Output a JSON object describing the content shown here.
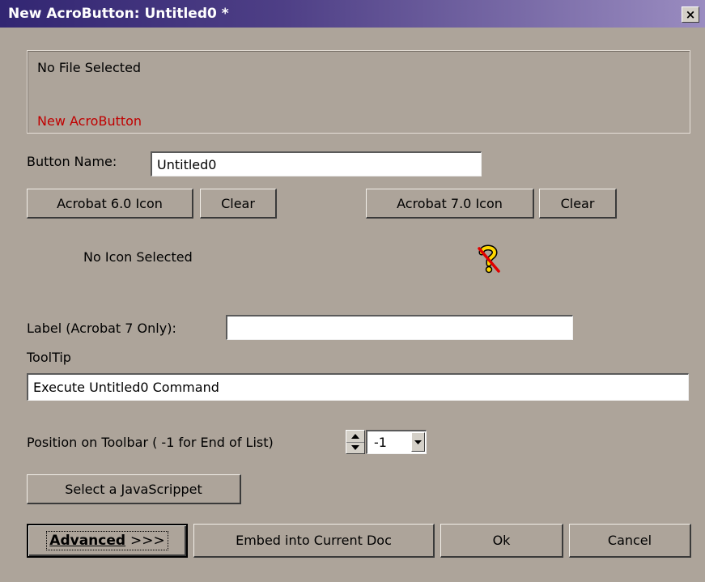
{
  "window": {
    "title": "New AcroButton: Untitled0 *",
    "close_label": "×"
  },
  "file_info": {
    "file_status": "No File Selected",
    "button_caption": "New AcroButton"
  },
  "button_name": {
    "label": "Button Name:",
    "value": "Untitled0"
  },
  "icons": {
    "acrobat6_button": "Acrobat 6.0 Icon",
    "clear6_button": "Clear",
    "acrobat7_button": "Acrobat 7.0 Icon",
    "clear7_button": "Clear",
    "acrobat6_status": "No Icon Selected",
    "acrobat7_icon": "missing-icon-question-mark"
  },
  "label_field": {
    "label": "Label (Acrobat 7 Only):",
    "value": ""
  },
  "tooltip": {
    "label": "ToolTip",
    "value": "Execute Untitled0 Command"
  },
  "position": {
    "label": "Position on Toolbar ( -1 for End of List)",
    "value": "-1"
  },
  "javascript_button": "Select a JavaScrippet",
  "footer": {
    "advanced_label": "Advanced",
    "advanced_arrows": ">>>",
    "embed_label": "Embed into Current Doc",
    "ok_label": "Ok",
    "cancel_label": "Cancel"
  },
  "colors": {
    "dialog_background": "#ada49a",
    "titlebar_start": "#322672",
    "titlebar_end": "#9a8cc0",
    "caption_red": "#c00000"
  }
}
